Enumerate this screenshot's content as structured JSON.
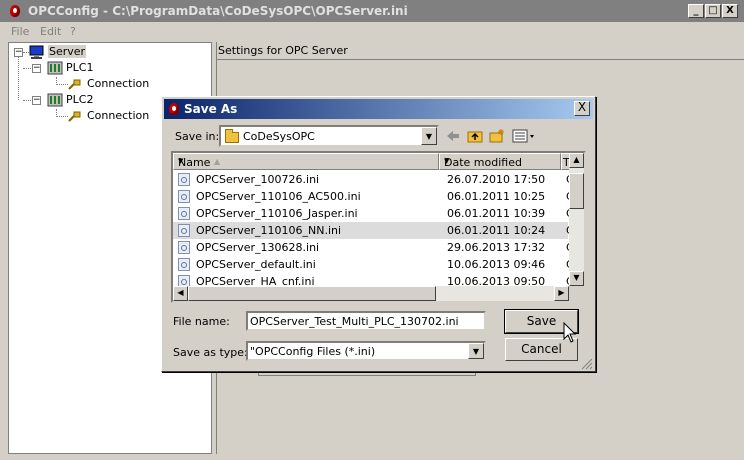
{
  "window": {
    "title": "OPCConfig - C:\\ProgramData\\CoDeSysOPC\\OPCServer.ini",
    "minimize": "_",
    "maximize": "□",
    "close": "X"
  },
  "menu": [
    "File",
    "Edit",
    "?"
  ],
  "tree": {
    "server": "Server",
    "plc1": "PLC1",
    "plc1_connection": "Connection",
    "plc2": "PLC2",
    "plc2_connection": "Connection"
  },
  "right_panel": {
    "header": "Settings for OPC Server"
  },
  "dialog": {
    "title": "Save As",
    "close": "X",
    "save_in_label": "Save in:",
    "save_in_value": "CoDeSysOPC",
    "columns": {
      "name": "Name",
      "date": "Date modified",
      "type": "T"
    },
    "files": [
      {
        "name": "OPCServer_100726.ini",
        "date": "26.07.2010 17:50",
        "extra": "C"
      },
      {
        "name": "OPCServer_110106_AC500.ini",
        "date": "06.01.2011 10:25",
        "extra": "C"
      },
      {
        "name": "OPCServer_110106_Jasper.ini",
        "date": "06.01.2011 10:39",
        "extra": "C"
      },
      {
        "name": "OPCServer_110106_NN.ini",
        "date": "06.01.2011 10:24",
        "extra": "C"
      },
      {
        "name": "OPCServer_130628.ini",
        "date": "29.06.2013 17:32",
        "extra": "C"
      },
      {
        "name": "OPCServer_default.ini",
        "date": "10.06.2013 09:46",
        "extra": "C"
      },
      {
        "name": "OPCServer_HA_cnf.ini",
        "date": "10.06.2013 09:50",
        "extra": "C"
      }
    ],
    "file_name_label": "File name:",
    "file_name_value": "OPCServer_Test_Multi_PLC_130702.ini",
    "save_type_label": "Save as type:",
    "save_type_value": "\"OPCConfig Files (*.ini)",
    "save_button": "Save",
    "cancel_button": "Cancel"
  },
  "icons": {
    "app": "opc-app-icon",
    "server": "monitor-icon",
    "plc": "plc-module-icon",
    "connection": "connection-plug-icon",
    "folder": "folder-icon",
    "back": "back-arrow-icon",
    "up": "up-folder-icon",
    "new_folder": "new-folder-icon",
    "views": "view-menu-icon",
    "file": "ini-file-icon"
  }
}
